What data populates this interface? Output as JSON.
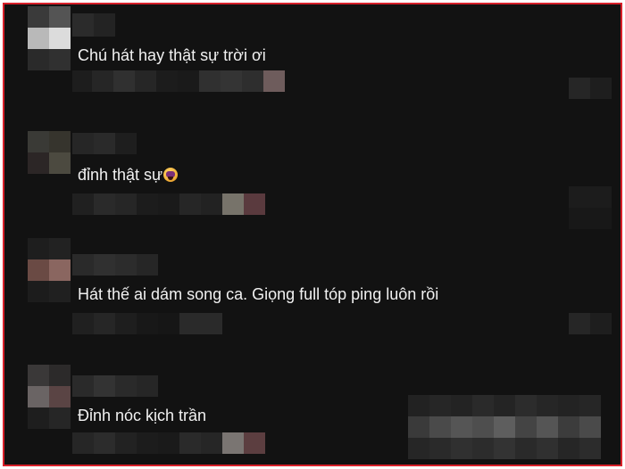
{
  "comments": [
    {
      "text": "Chú hát hay thật sự trời ơi"
    },
    {
      "text": "đỉnh thật sự"
    },
    {
      "text": "Hát thế ai dám song ca. Giọng full tóp ping luôn rồi"
    },
    {
      "text": "Đỉnh nóc kịch trần"
    }
  ],
  "emoji_icon": "screaming-face-emoji",
  "colors": {
    "border": "#d8202a",
    "background": "#121212",
    "text": "#f1f1f1"
  }
}
